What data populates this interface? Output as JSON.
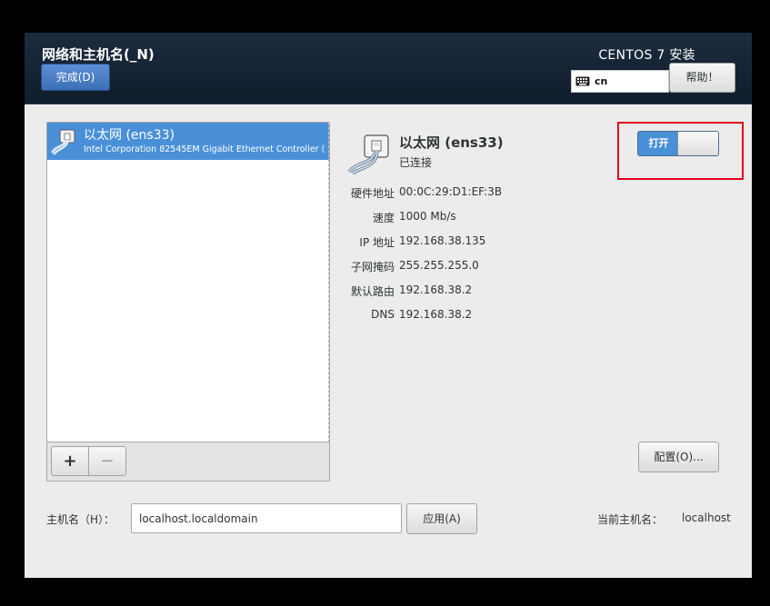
{
  "header": {
    "title": "网络和主机名(_N)",
    "done_label": "完成(D)",
    "product": "CENTOS 7 安装",
    "keyboard_layout": "cn",
    "help_label": "帮助！"
  },
  "devices": [
    {
      "name": "以太网 (ens33)",
      "description": "Intel Corporation 82545EM Gigabit Ethernet Controller ("
    }
  ],
  "list_toolbar": {
    "add": "+",
    "remove": "−"
  },
  "detail": {
    "name": "以太网 (ens33)",
    "status": "已连接",
    "switch_label": "打开",
    "switch_on": true,
    "properties": [
      {
        "label": "硬件地址",
        "value": "00:0C:29:D1:EF:3B"
      },
      {
        "label": "速度",
        "value": "1000 Mb/s"
      },
      {
        "label": "IP 地址",
        "value": "192.168.38.135"
      },
      {
        "label": "子网掩码",
        "value": "255.255.255.0"
      },
      {
        "label": "默认路由",
        "value": "192.168.38.2"
      },
      {
        "label": "DNS",
        "value": "192.168.38.2"
      }
    ],
    "config_label": "配置(O)..."
  },
  "hostname": {
    "label": "主机名（H）：",
    "value": "localhost.localdomain",
    "apply_label": "应用(A)",
    "current_label": "当前主机名：",
    "current_value": "localhost"
  },
  "colors": {
    "accent": "#4a90d9",
    "header_bg": "#13212f",
    "highlight": "#e3001b"
  }
}
